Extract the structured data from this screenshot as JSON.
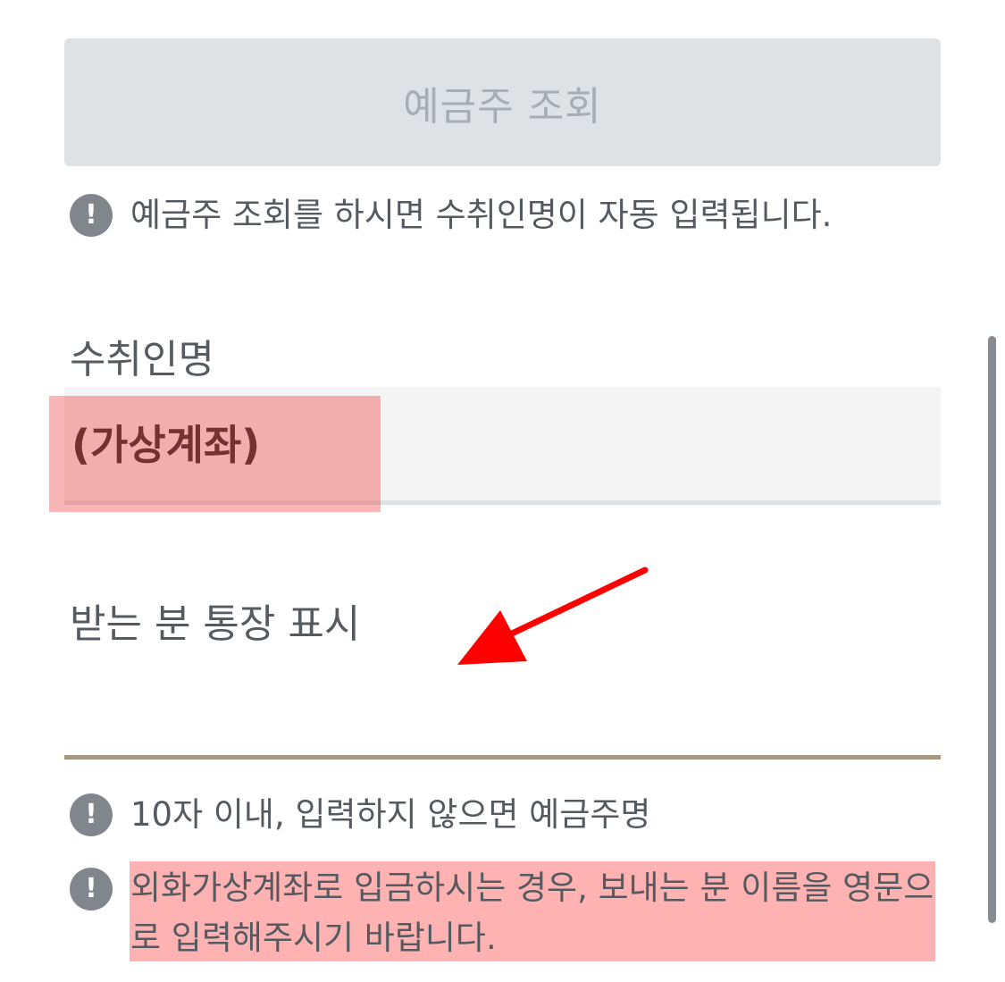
{
  "lookup_button": {
    "label": "예금주 조회"
  },
  "notes": {
    "lookup_hint": "예금주 조회를 하시면 수취인명이 자동 입력됩니다.",
    "memo_limit": "10자 이내, 입력하지 않으면 예금주명",
    "foreign_currency": "외화가상계좌로 입금하시는 경우, 보내는 분 이름을 영문으로 입력해주시기 바랍니다."
  },
  "recipient": {
    "label": "수취인명",
    "value": "(가상계좌)"
  },
  "memo": {
    "label": "받는 분 통장 표시",
    "value": ""
  },
  "colors": {
    "button_bg": "#dfe2e5",
    "button_text": "#a8adb3",
    "info_icon": "#81868c",
    "memo_underline": "#a89875",
    "annotation_red": "#ff0000"
  }
}
